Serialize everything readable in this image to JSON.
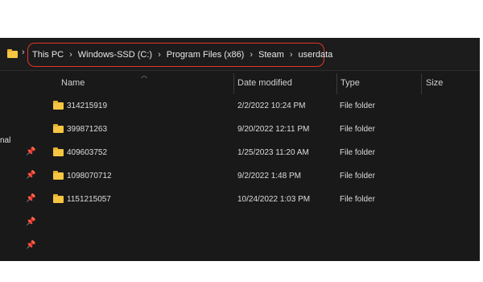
{
  "address_bar": {
    "breadcrumbs": [
      "This PC",
      "Windows-SSD (C:)",
      "Program Files (x86)",
      "Steam",
      "userdata"
    ],
    "separator": "›"
  },
  "sidebar": {
    "partial_label": "nal"
  },
  "columns": {
    "name": "Name",
    "date_modified": "Date modified",
    "type": "Type",
    "size": "Size"
  },
  "files": [
    {
      "name": "314215919",
      "date_modified": "2/2/2022 10:24 PM",
      "type": "File folder"
    },
    {
      "name": "399871263",
      "date_modified": "9/20/2022 12:11 PM",
      "type": "File folder"
    },
    {
      "name": "409603752",
      "date_modified": "1/25/2023 11:20 AM",
      "type": "File folder"
    },
    {
      "name": "1098070712",
      "date_modified": "9/2/2022 1:48 PM",
      "type": "File folder"
    },
    {
      "name": "1151215057",
      "date_modified": "10/24/2022 1:03 PM",
      "type": "File folder"
    }
  ],
  "colors": {
    "window_bg": "#191919",
    "highlight": "#e0352b",
    "folder": "#f6c642"
  }
}
